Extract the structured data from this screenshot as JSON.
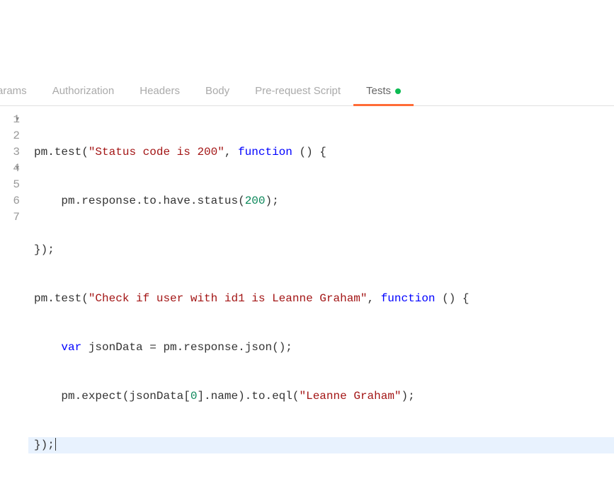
{
  "tabs": {
    "params": "arams",
    "authorization": "Authorization",
    "headers": "Headers",
    "body": "Body",
    "prerequest": "Pre-request Script",
    "tests": "Tests"
  },
  "gutter": {
    "l1": "1",
    "l2": "2",
    "l3": "3",
    "l4": "4",
    "l5": "5",
    "l6": "6",
    "l7": "7"
  },
  "code": {
    "l1": {
      "a": "pm",
      "b": ".",
      "c": "test",
      "d": "(",
      "e": "\"Status code is 200\"",
      "f": ", ",
      "g": "function",
      "h": " () {"
    },
    "l2": {
      "a": "    pm",
      "b": ".",
      "c": "response",
      "d": ".",
      "e": "to",
      "f": ".",
      "g": "have",
      "h": ".",
      "i": "status",
      "j": "(",
      "k": "200",
      "l": ");"
    },
    "l3": {
      "a": "});"
    },
    "l4": {
      "a": "pm",
      "b": ".",
      "c": "test",
      "d": "(",
      "e": "\"Check if user with id1 is Leanne Graham\"",
      "f": ", ",
      "g": "function",
      "h": " () {"
    },
    "l5": {
      "a": "    ",
      "b": "var",
      "c": " jsonData ",
      "d": "=",
      "e": " pm",
      "f": ".",
      "g": "response",
      "h": ".",
      "i": "json",
      "j": "();"
    },
    "l6": {
      "a": "    pm",
      "b": ".",
      "c": "expect",
      "d": "(jsonData[",
      "e": "0",
      "f": "].",
      "g": "name",
      "h": ").",
      "i": "to",
      "j": ".",
      "k": "eql",
      "l": "(",
      "m": "\"Leanne Graham\"",
      "n": ");"
    },
    "l7": {
      "a": "});"
    }
  }
}
